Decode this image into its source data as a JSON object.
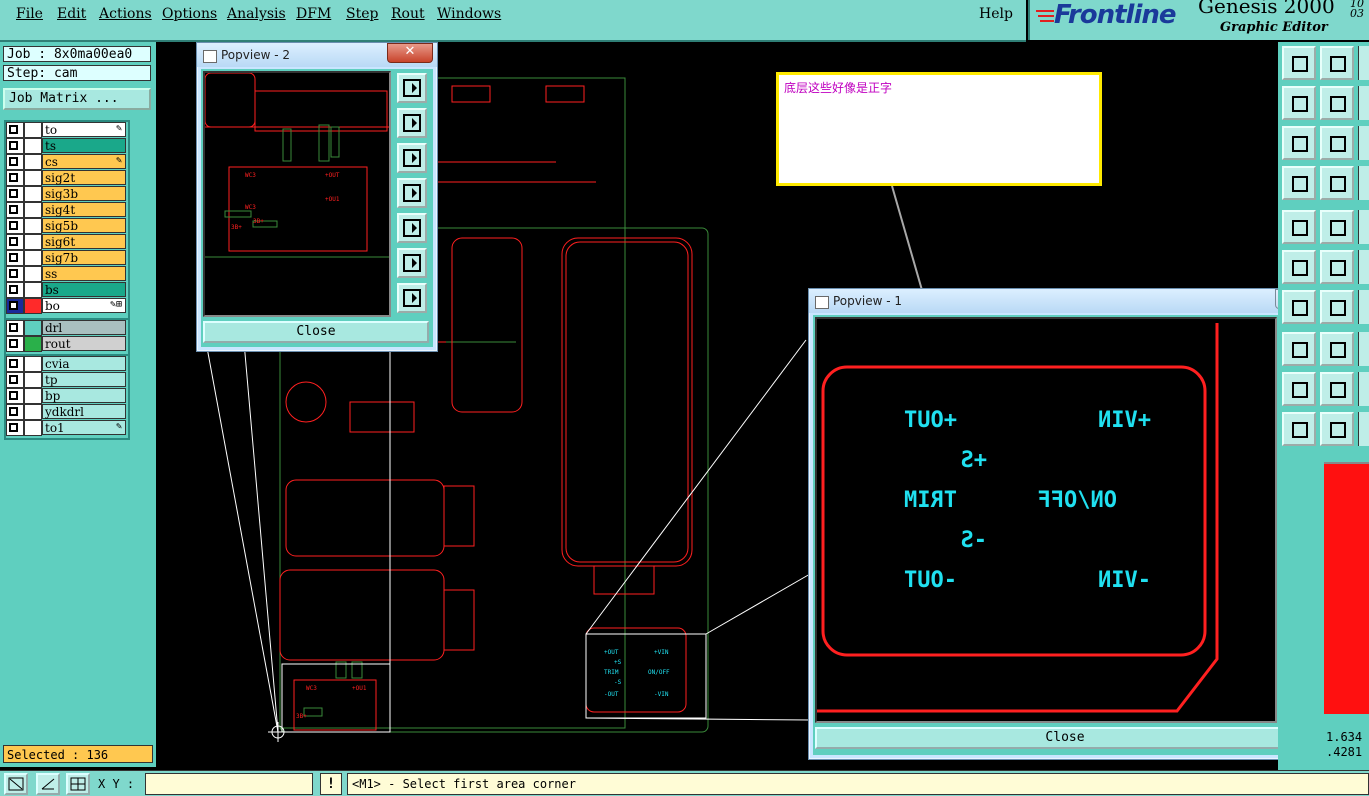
{
  "menubar": {
    "items": [
      "File",
      "Edit",
      "Actions",
      "Options",
      "Analysis",
      "DFM",
      "Step",
      "Rout",
      "Windows"
    ],
    "help": "Help"
  },
  "brand": {
    "logo": "Frontline",
    "product": "Genesis 2000",
    "subtitle": "Graphic Editor",
    "version_top": "10",
    "version_bottom": "03"
  },
  "job": {
    "job_line": "Job : 8x0ma00ea0",
    "step_line": "Step: cam",
    "matrix_button": "Job Matrix ..."
  },
  "layers_group1": [
    {
      "name": "to",
      "color": "#ffffff",
      "flag": "edit"
    },
    {
      "name": "ts",
      "color": "#1aa88a",
      "flag": ""
    },
    {
      "name": "cs",
      "color": "#ffc850",
      "flag": "edit"
    },
    {
      "name": "sig2t",
      "color": "#ffc850",
      "flag": ""
    },
    {
      "name": "sig3b",
      "color": "#ffc850",
      "flag": ""
    },
    {
      "name": "sig4t",
      "color": "#ffc850",
      "flag": ""
    },
    {
      "name": "sig5b",
      "color": "#ffc850",
      "flag": ""
    },
    {
      "name": "sig6t",
      "color": "#ffc850",
      "flag": ""
    },
    {
      "name": "sig7b",
      "color": "#ffc850",
      "flag": ""
    },
    {
      "name": "ss",
      "color": "#ffc850",
      "flag": ""
    },
    {
      "name": "bs",
      "color": "#1aa88a",
      "flag": ""
    },
    {
      "name": "bo",
      "color": "#ffffff",
      "flag": "edit-plus",
      "active": true
    }
  ],
  "layers_group2": [
    {
      "name": "drl",
      "color": "#a9c0c0"
    },
    {
      "name": "rout",
      "color": "#d0d0d0"
    }
  ],
  "layers_group3": [
    {
      "name": "cvia",
      "color": "#a8e8e0"
    },
    {
      "name": "tp",
      "color": "#a8e8e0"
    },
    {
      "name": "bp",
      "color": "#a8e8e0"
    },
    {
      "name": "ydkdrl",
      "color": "#a8e8e0"
    },
    {
      "name": "to1",
      "color": "#a8e8e0",
      "flag": "edit"
    }
  ],
  "selected": "Selected : 136",
  "status": {
    "xy_label": "X Y :",
    "xy_value": "",
    "message": "<M1> - Select first area corner"
  },
  "coords": {
    "line1": "1.634",
    "line2": ".4281"
  },
  "popview2": {
    "title": "Popview - 2",
    "close": "Close",
    "labels": [
      "WC3",
      "+OUT",
      "WC3",
      "+OU1",
      "3B+",
      "3B+"
    ]
  },
  "popview1": {
    "title": "Popview - 1",
    "close": "Close",
    "labels": [
      "+OUT",
      "+VIN",
      "+S",
      "TRIM",
      "ON/OFF",
      "-S",
      "-OUT",
      "-VIN"
    ]
  },
  "board_labels": [
    "+OUT",
    "+VIN",
    "+S",
    "ON/OFF",
    "TRIM",
    "-S",
    "-OUT",
    "-VIN"
  ],
  "note": {
    "text": "底层这些好像是正字"
  },
  "colors": {
    "accent": "#5fcfbf",
    "menu": "#7fd8cc",
    "trace": "#ff2020",
    "outline": "#3a8a3a",
    "text_cyan": "#20e0f0"
  },
  "icons": [
    "window-close-icon",
    "zoom-home-icon",
    "zoom-in-icon",
    "zoom-out-icon",
    "pan-left-icon",
    "pan-right-icon",
    "zoom-fit-icon",
    "zoom-center-icon",
    "select-tool-icon",
    "grid-icon",
    "snap-icon",
    "measure-icon",
    "route-icon",
    "cross-icon",
    "arrow-icon"
  ]
}
